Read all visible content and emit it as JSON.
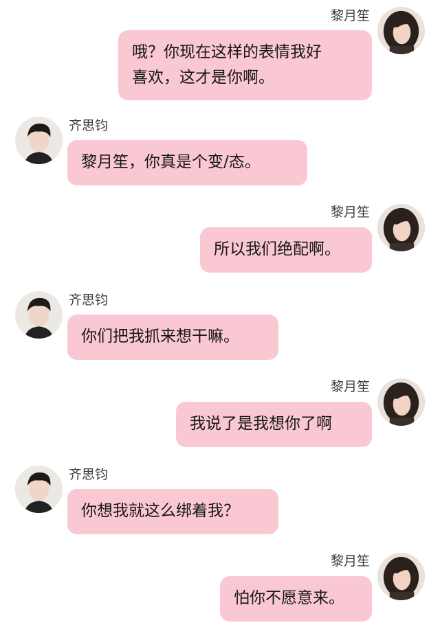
{
  "colors": {
    "bubble": "#fac8d3",
    "background": "#ffffff",
    "name_text": "#3c3c3c",
    "message_text": "#161616"
  },
  "messages": [
    {
      "side": "right",
      "sender": "黎月笙",
      "avatar_icon": "female-avatar-icon",
      "lines": [
        "哦？你现在这样的表情我好",
        "喜欢，这才是你啊。"
      ]
    },
    {
      "side": "left",
      "sender": "齐思钧",
      "avatar_icon": "male-avatar-icon",
      "lines": [
        "黎月笙，你真是个变/态。"
      ]
    },
    {
      "side": "right",
      "sender": "黎月笙",
      "avatar_icon": "female-avatar-icon",
      "lines": [
        "所以我们绝配啊。"
      ]
    },
    {
      "side": "left",
      "sender": "齐思钧",
      "avatar_icon": "male-avatar-icon",
      "lines": [
        "你们把我抓来想干嘛。"
      ]
    },
    {
      "side": "right",
      "sender": "黎月笙",
      "avatar_icon": "female-avatar-icon",
      "lines": [
        "我说了是我想你了啊"
      ]
    },
    {
      "side": "left",
      "sender": "齐思钧",
      "avatar_icon": "male-avatar-icon",
      "lines": [
        "你想我就这么绑着我？"
      ]
    },
    {
      "side": "right",
      "sender": "黎月笙",
      "avatar_icon": "female-avatar-icon",
      "lines": [
        "怕你不愿意来。"
      ]
    }
  ]
}
